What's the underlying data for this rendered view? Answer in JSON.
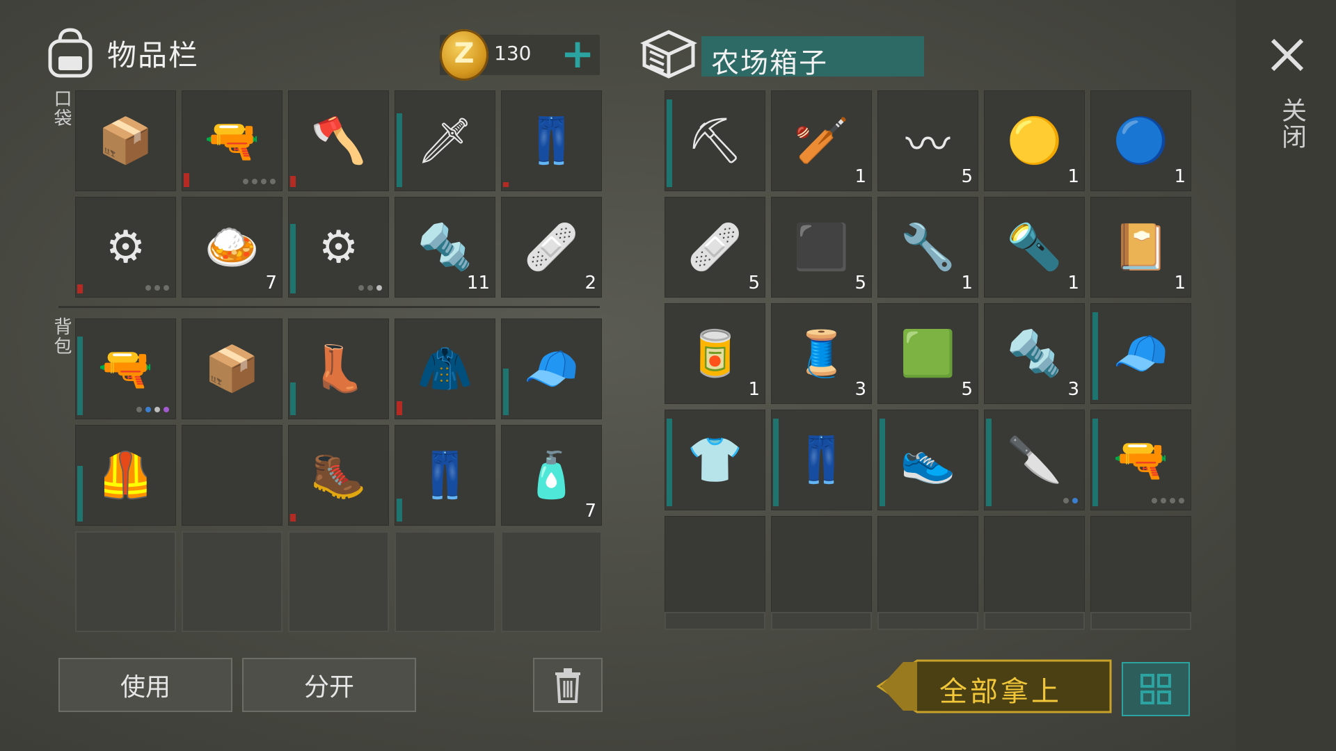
{
  "inventory": {
    "title": "物品栏",
    "coins": "130",
    "add_icon": "plus-icon",
    "pockets_label": "口袋",
    "backpack_label": "背包",
    "pockets": [
      {
        "icon": "cardboard-box-icon",
        "glyph": "📦",
        "qty": "",
        "bar": null,
        "dots": []
      },
      {
        "icon": "assault-rifle-icon",
        "glyph": "🔫",
        "qty": "",
        "bar": {
          "color": "red",
          "pct": 0.15
        },
        "dots": [
          "g",
          "g",
          "g",
          "g"
        ]
      },
      {
        "icon": "hatchet-icon",
        "glyph": "🪓",
        "qty": "",
        "bar": {
          "color": "red",
          "pct": 0.12
        },
        "dots": []
      },
      {
        "icon": "katana-icon",
        "glyph": "🗡",
        "qty": "",
        "bar": {
          "color": "teal",
          "pct": 0.8
        },
        "dots": []
      },
      {
        "icon": "camo-pants-icon",
        "glyph": "👖",
        "qty": "",
        "bar": {
          "color": "red",
          "pct": 0.05
        },
        "dots": []
      },
      {
        "icon": "sawblade-mace-icon",
        "glyph": "⚙",
        "qty": "",
        "bar": {
          "color": "red",
          "pct": 0.1
        },
        "dots": [
          "g",
          "g",
          "g"
        ]
      },
      {
        "icon": "food-plate-icon",
        "glyph": "🍛",
        "qty": "7",
        "bar": null,
        "dots": []
      },
      {
        "icon": "sawblade-mace-icon",
        "glyph": "⚙",
        "qty": "",
        "bar": {
          "color": "teal",
          "pct": 0.75
        },
        "dots": [
          "g",
          "g",
          "w"
        ]
      },
      {
        "icon": "bolt-nut-icon",
        "glyph": "🔩",
        "qty": "11",
        "bar": null,
        "dots": []
      },
      {
        "icon": "bandage-icon",
        "glyph": "🩹",
        "qty": "2",
        "bar": null,
        "dots": []
      }
    ],
    "backpack": [
      {
        "icon": "shotgun-icon",
        "glyph": "🔫",
        "qty": "",
        "bar": {
          "color": "teal",
          "pct": 0.85
        },
        "dots": [
          "g",
          "b",
          "w",
          "p"
        ]
      },
      {
        "icon": "cardboard-box-icon",
        "glyph": "📦",
        "qty": "",
        "bar": null,
        "dots": []
      },
      {
        "icon": "leather-boots-icon",
        "glyph": "👢",
        "qty": "",
        "bar": {
          "color": "teal",
          "pct": 0.35
        },
        "dots": []
      },
      {
        "icon": "jacket-icon",
        "glyph": "🧥",
        "qty": "",
        "bar": {
          "color": "red",
          "pct": 0.15
        },
        "dots": []
      },
      {
        "icon": "beanie-icon",
        "glyph": "🧢",
        "qty": "",
        "bar": {
          "color": "teal",
          "pct": 0.5
        },
        "dots": []
      },
      {
        "icon": "armor-vest-icon",
        "glyph": "🦺",
        "qty": "",
        "bar": {
          "color": "teal",
          "pct": 0.6
        },
        "dots": []
      },
      {
        "icon": "",
        "glyph": "",
        "qty": "",
        "bar": null,
        "dots": [],
        "blank": true
      },
      {
        "icon": "combat-boots-icon",
        "glyph": "🥾",
        "qty": "",
        "bar": {
          "color": "red",
          "pct": 0.08
        },
        "dots": []
      },
      {
        "icon": "patched-pants-icon",
        "glyph": "👖",
        "qty": "",
        "bar": {
          "color": "teal",
          "pct": 0.25
        },
        "dots": []
      },
      {
        "icon": "glue-icon",
        "glyph": "🧴",
        "qty": "7",
        "bar": null,
        "dots": []
      }
    ],
    "use_label": "使用",
    "split_label": "分开",
    "trash_icon": "trash-icon"
  },
  "box": {
    "title": "农场箱子",
    "icon": "crate-icon",
    "items": [
      {
        "icon": "shovel-icon",
        "glyph": "⛏",
        "qty": "",
        "bar": {
          "color": "teal",
          "pct": 0.95
        },
        "dots": []
      },
      {
        "icon": "blueprint-bat-icon",
        "glyph": "🏏",
        "qty": "1",
        "bar": null,
        "dots": []
      },
      {
        "icon": "spring-icon",
        "glyph": "〰",
        "qty": "5",
        "bar": null,
        "dots": []
      },
      {
        "icon": "yellow-spray-paint-icon",
        "glyph": "🟡",
        "qty": "1",
        "bar": null,
        "dots": []
      },
      {
        "icon": "blue-spray-paint-icon",
        "glyph": "🔵",
        "qty": "1",
        "bar": null,
        "dots": []
      },
      {
        "icon": "bandage-icon",
        "glyph": "🩹",
        "qty": "5",
        "bar": null,
        "dots": []
      },
      {
        "icon": "metal-plate-icon",
        "glyph": "⬛",
        "qty": "5",
        "bar": null,
        "dots": []
      },
      {
        "icon": "wrench-icon",
        "glyph": "🔧",
        "qty": "1",
        "bar": null,
        "dots": []
      },
      {
        "icon": "flashlight-icon",
        "glyph": "🔦",
        "qty": "1",
        "bar": null,
        "dots": []
      },
      {
        "icon": "diary-icon",
        "glyph": "📔",
        "qty": "1",
        "bar": null,
        "dots": []
      },
      {
        "icon": "energy-drink-icon",
        "glyph": "🥫",
        "qty": "1",
        "bar": null,
        "dots": []
      },
      {
        "icon": "wire-spool-icon",
        "glyph": "🧵",
        "qty": "3",
        "bar": null,
        "dots": []
      },
      {
        "icon": "cloth-icon",
        "glyph": "🟩",
        "qty": "5",
        "bar": null,
        "dots": []
      },
      {
        "icon": "bolt-nut-icon",
        "glyph": "🔩",
        "qty": "3",
        "bar": null,
        "dots": []
      },
      {
        "icon": "beanie-icon",
        "glyph": "🧢",
        "qty": "",
        "bar": {
          "color": "teal",
          "pct": 0.95
        },
        "dots": []
      },
      {
        "icon": "vest-shirt-icon",
        "glyph": "👕",
        "qty": "",
        "bar": {
          "color": "teal",
          "pct": 0.95
        },
        "dots": []
      },
      {
        "icon": "jeans-icon",
        "glyph": "👖",
        "qty": "",
        "bar": {
          "color": "teal",
          "pct": 0.95
        },
        "dots": []
      },
      {
        "icon": "sneakers-icon",
        "glyph": "👟",
        "qty": "",
        "bar": {
          "color": "teal",
          "pct": 0.95
        },
        "dots": []
      },
      {
        "icon": "cleaver-icon",
        "glyph": "🔪",
        "qty": "",
        "bar": {
          "color": "teal",
          "pct": 0.95
        },
        "dots": [
          "g",
          "b"
        ]
      },
      {
        "icon": "assault-rifle-icon",
        "glyph": "🔫",
        "qty": "",
        "bar": {
          "color": "teal",
          "pct": 0.95
        },
        "dots": [
          "g",
          "g",
          "g",
          "g"
        ]
      }
    ],
    "take_all_label": "全部拿上",
    "grid_view_icon": "grid-view-icon"
  },
  "close": {
    "icon": "close-icon",
    "label": "关闭"
  },
  "colors": {
    "accent_teal": "#2ba3a0",
    "title_bar": "#2d6a66",
    "durability_red": "#b52a23",
    "gold": "#f2c83a"
  }
}
